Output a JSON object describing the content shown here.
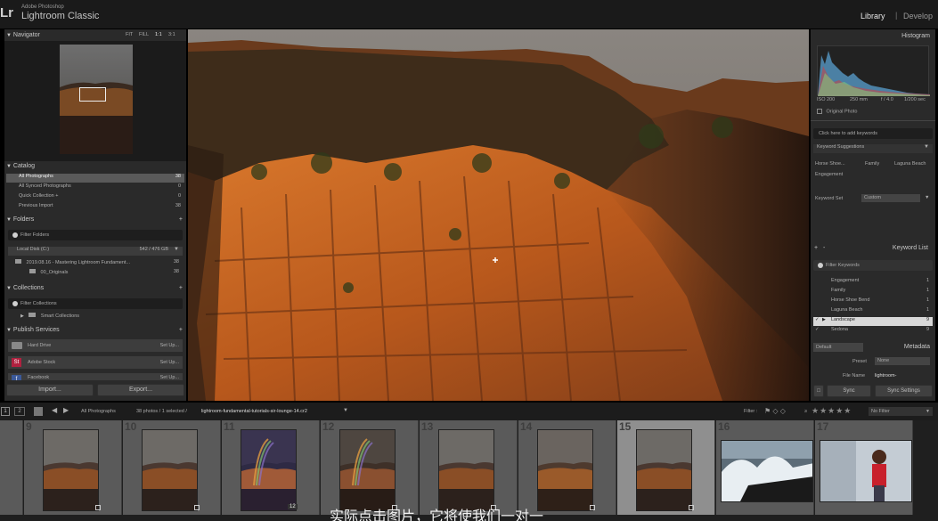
{
  "app": {
    "logo": "Lr",
    "vendor": "Adobe Photoshop",
    "name": "Lightroom Classic",
    "modules": [
      "Library",
      "Develop"
    ],
    "module_sep": "|"
  },
  "navigator": {
    "title": "Navigator",
    "zoom_options": [
      "FIT",
      "FILL",
      "1:1",
      "3:1"
    ]
  },
  "catalog": {
    "title": "Catalog",
    "items": [
      {
        "label": "All Photographs",
        "count": "38"
      },
      {
        "label": "All Synced Photographs",
        "count": "0"
      },
      {
        "label": "Quick Collection +",
        "count": "0"
      },
      {
        "label": "Previous Import",
        "count": "38"
      }
    ]
  },
  "folders": {
    "title": "Folders",
    "add": "+",
    "filter_placeholder": "Filter Folders",
    "disk_label": "Local Disk (C:)",
    "disk_space": "542 / 476 GB",
    "items": [
      {
        "label": "2019.08.16 - Mastering Lightroom Fundament...",
        "count": "38"
      },
      {
        "label": "00_Originals",
        "count": "38"
      }
    ]
  },
  "collections": {
    "title": "Collections",
    "add": "+",
    "filter_placeholder": "Filter Collections",
    "items": [
      {
        "label": "Smart Collections"
      }
    ]
  },
  "publish": {
    "title": "Publish Services",
    "add": "+",
    "items": [
      {
        "label": "Hard Drive",
        "action": "Set Up..."
      },
      {
        "label": "Adobe Stock",
        "action": "Set Up..."
      },
      {
        "label": "Facebook",
        "action": "Set Up..."
      }
    ]
  },
  "left_buttons": {
    "import": "Import...",
    "export": "Export..."
  },
  "histogram": {
    "title": "Histogram",
    "iso": "ISO 200",
    "focal": "250 mm",
    "aperture": "f / 4.0",
    "shutter": "1/200 sec",
    "original_photo": "Original Photo"
  },
  "keywording": {
    "placeholder": "Click here to add keywords",
    "suggestions_title": "Keyword Suggestions",
    "suggestions": [
      "Horse Shoe...",
      "Family",
      "Laguna Beach",
      "Engagement"
    ],
    "set_label": "Keyword Set",
    "set_value": "Custom"
  },
  "keyword_list": {
    "title": "Keyword List",
    "add": "+",
    "remove": "-",
    "filter_placeholder": "Filter Keywords",
    "items": [
      {
        "label": "Engagement",
        "count": "1",
        "checked": false
      },
      {
        "label": "Family",
        "count": "1",
        "checked": false
      },
      {
        "label": "Horse Shoe Bend",
        "count": "1",
        "checked": false
      },
      {
        "label": "Laguna Beach",
        "count": "1",
        "checked": false
      },
      {
        "label": "Landscape",
        "count": "9",
        "checked": true
      },
      {
        "label": "Sedona",
        "count": "9",
        "checked": true
      }
    ]
  },
  "metadata": {
    "title": "Metadata",
    "preset_dropdown": "Default",
    "preset_label": "Preset",
    "preset_value": "None",
    "filename_label": "File Name",
    "filename_value": "lightroom-"
  },
  "sync": {
    "sync": "Sync",
    "sync_settings": "Sync Settings"
  },
  "toolbar": {
    "page1": "1",
    "page2": "2",
    "source": "All Photographs",
    "info": "38 photos / 1 selected /",
    "filename": "lightroom-fundamental-tutorials-sir-lounge-14.cr2",
    "filter_label": "Filter :",
    "filter_compare": "≥",
    "filter_value": "No Filter"
  },
  "filmstrip": {
    "cells": [
      {
        "num": "9",
        "kind": "landscape",
        "badge": ""
      },
      {
        "num": "10",
        "kind": "landscape",
        "badge": ""
      },
      {
        "num": "11",
        "kind": "rainbow",
        "badge": "12"
      },
      {
        "num": "12",
        "kind": "rainbow2",
        "badge": ""
      },
      {
        "num": "13",
        "kind": "landscape",
        "badge": ""
      },
      {
        "num": "14",
        "kind": "landscape2",
        "badge": ""
      },
      {
        "num": "15",
        "kind": "landscape",
        "badge": "",
        "selected": true
      },
      {
        "num": "16",
        "kind": "wave",
        "badge": ""
      },
      {
        "num": "17",
        "kind": "portrait",
        "badge": ""
      }
    ]
  },
  "subtitle": "实际点击图片，它将使我们一对一",
  "colors": {
    "accent": "#c8c8c8",
    "panel": "#2a2a2a",
    "rock": "#c2631f"
  }
}
